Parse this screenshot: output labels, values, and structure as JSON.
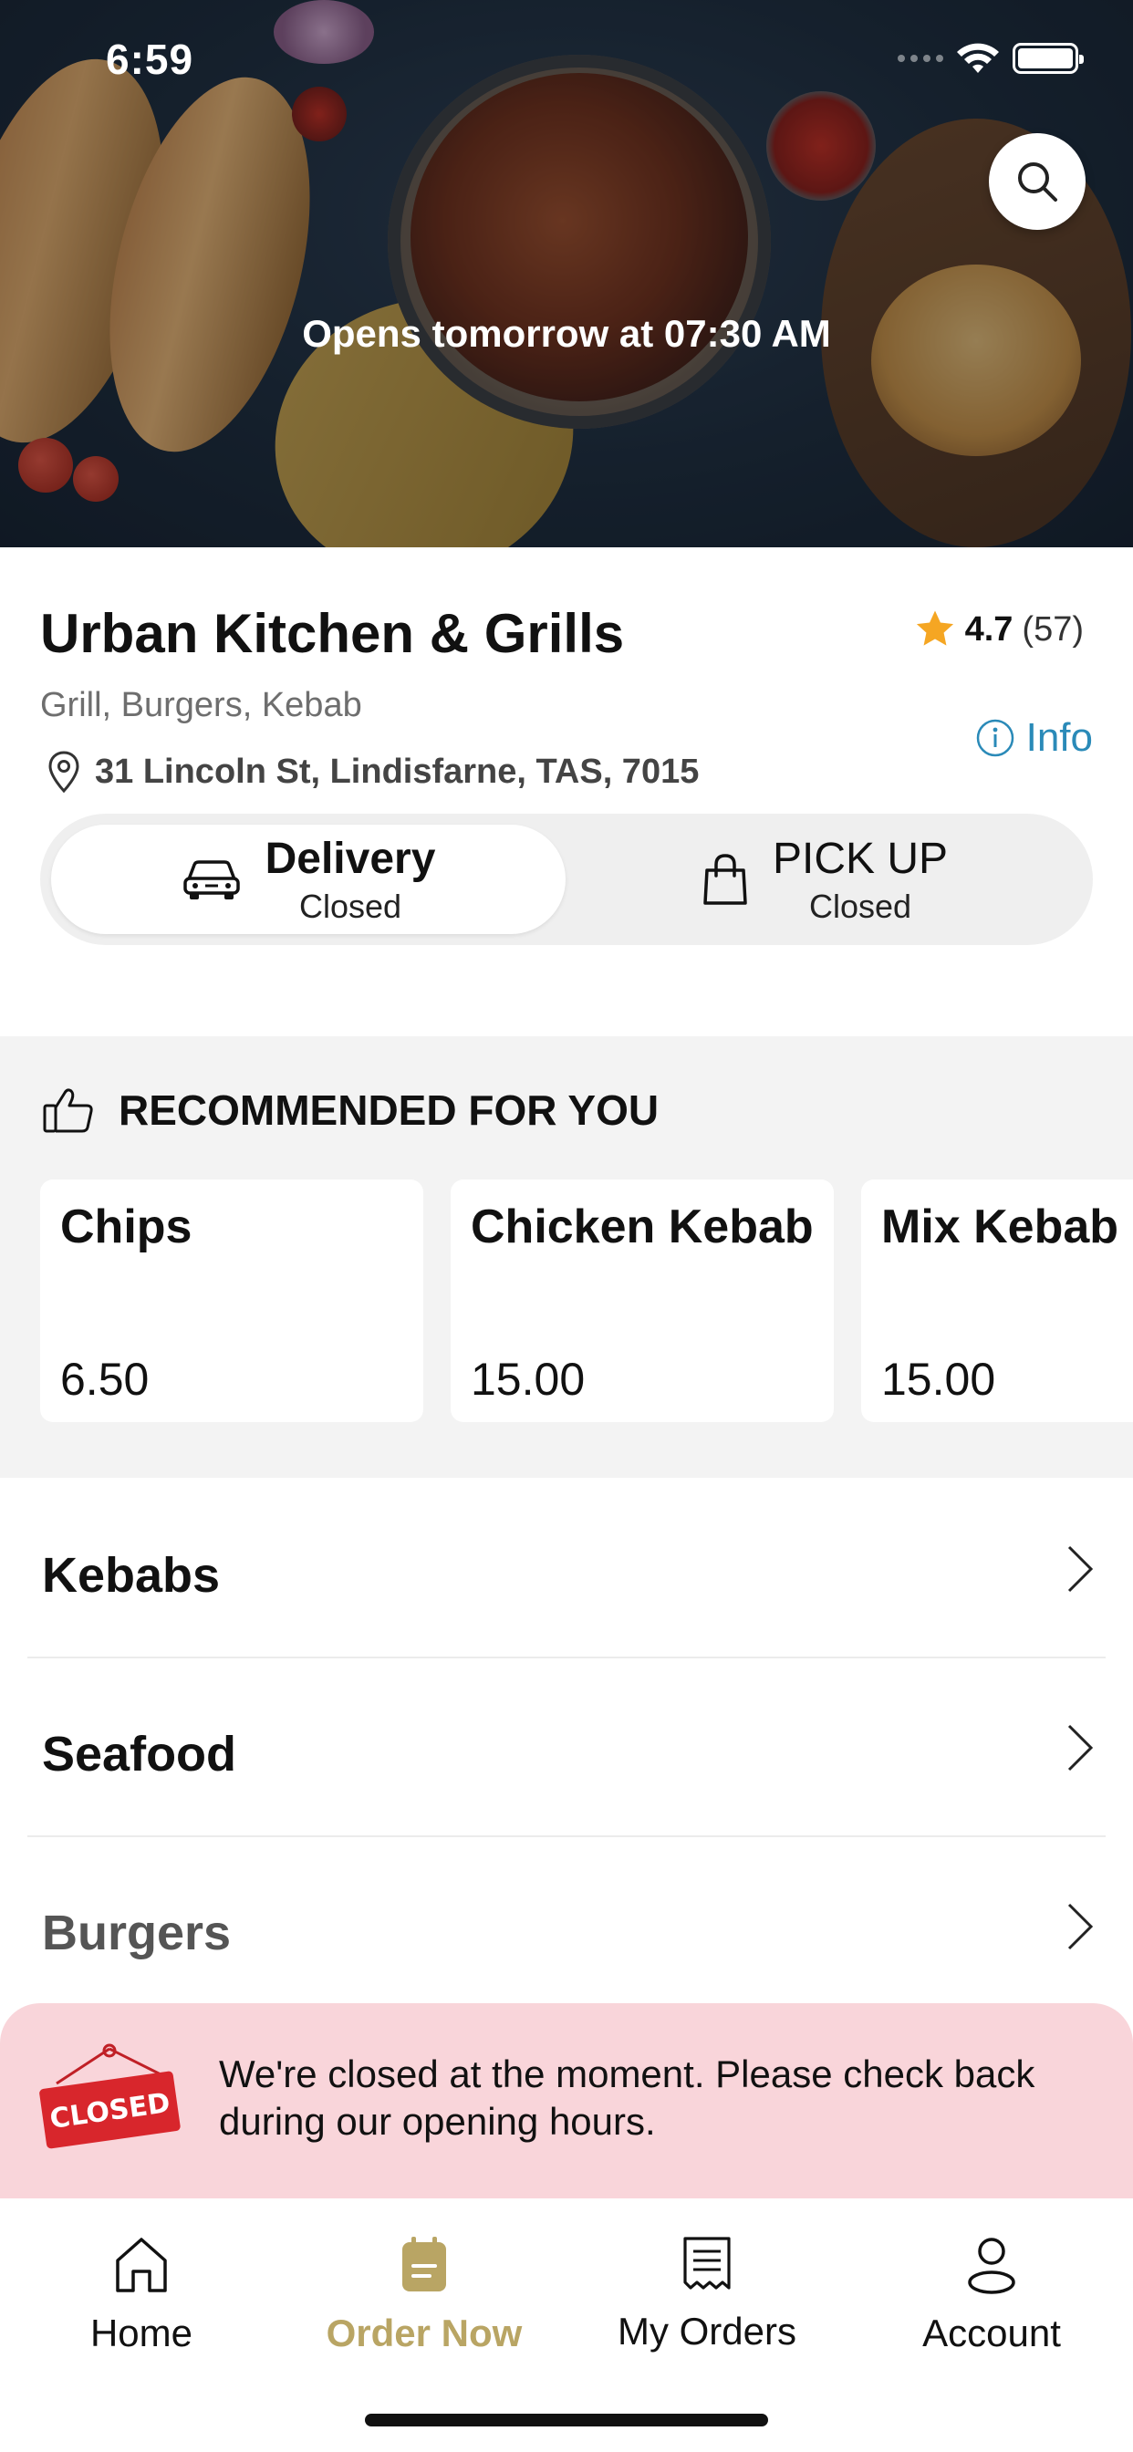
{
  "status_bar": {
    "time": "6:59"
  },
  "hero": {
    "status_message": "Opens tomorrow at 07:30 AM"
  },
  "restaurant": {
    "name": "Urban Kitchen & Grills",
    "rating": "4.7",
    "rating_count": "(57)",
    "cuisine": "Grill, Burgers, Kebab",
    "address": "31 Lincoln St, Lindisfarne, TAS, 7015",
    "info_label": "Info"
  },
  "order_mode": {
    "delivery": {
      "title": "Delivery",
      "status": "Closed"
    },
    "pickup": {
      "title": "PICK UP",
      "status": "Closed"
    }
  },
  "recommended": {
    "title": "RECOMMENDED FOR YOU",
    "items": [
      {
        "name": "Chips",
        "price": "6.50"
      },
      {
        "name": "Chicken Kebab",
        "price": "15.00"
      },
      {
        "name": "Mix Kebab",
        "price": "15.00"
      }
    ]
  },
  "categories": [
    "Kebabs",
    "Seafood",
    "Burgers"
  ],
  "closed_banner": {
    "sign_text": "CLOSED",
    "message": "We're closed at the moment. Please check back during our opening hours."
  },
  "tabbar": {
    "items": [
      {
        "label": "Home",
        "icon": "home-icon"
      },
      {
        "label": "Order Now",
        "icon": "order-bag-icon"
      },
      {
        "label": "My Orders",
        "icon": "receipt-icon"
      },
      {
        "label": "Account",
        "icon": "person-icon"
      }
    ],
    "active_color": "#b9a564"
  },
  "colors": {
    "accent": "#b9a564",
    "link": "#2a8ab8",
    "star": "#f5a623",
    "banner_bg": "#f9d5da",
    "closed_sign": "#d8262c"
  }
}
